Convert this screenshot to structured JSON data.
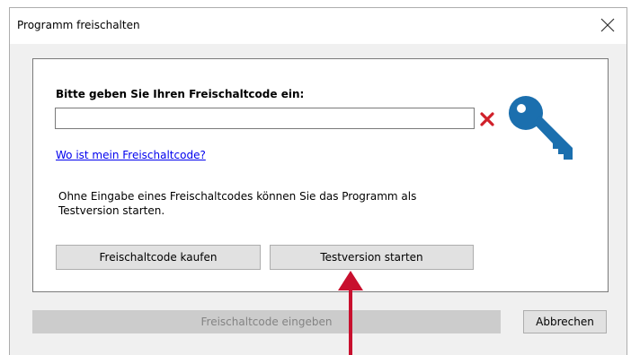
{
  "window": {
    "title": "Programm freischalten"
  },
  "dialog": {
    "prompt": "Bitte geben Sie Ihren Freischaltcode ein:",
    "code_value": "",
    "code_placeholder": "",
    "help_link": "Wo ist mein Freischaltcode?",
    "info_line1": "Ohne Eingabe eines Freischaltcodes können Sie das Programm als",
    "info_line2": "Testversion starten.",
    "buy_button": "Freischaltcode kaufen",
    "trial_button": "Testversion starten"
  },
  "footer": {
    "enter_button": "Freischaltcode eingeben",
    "cancel_button": "Abbrechen"
  },
  "icons": {
    "close": "close-icon",
    "invalid": "red-x-icon",
    "key": "key-icon"
  },
  "colors": {
    "key_blue": "#1b6fae",
    "error_red": "#d0202a",
    "annotation_red": "#c8102e",
    "link_blue": "#0000ee"
  }
}
